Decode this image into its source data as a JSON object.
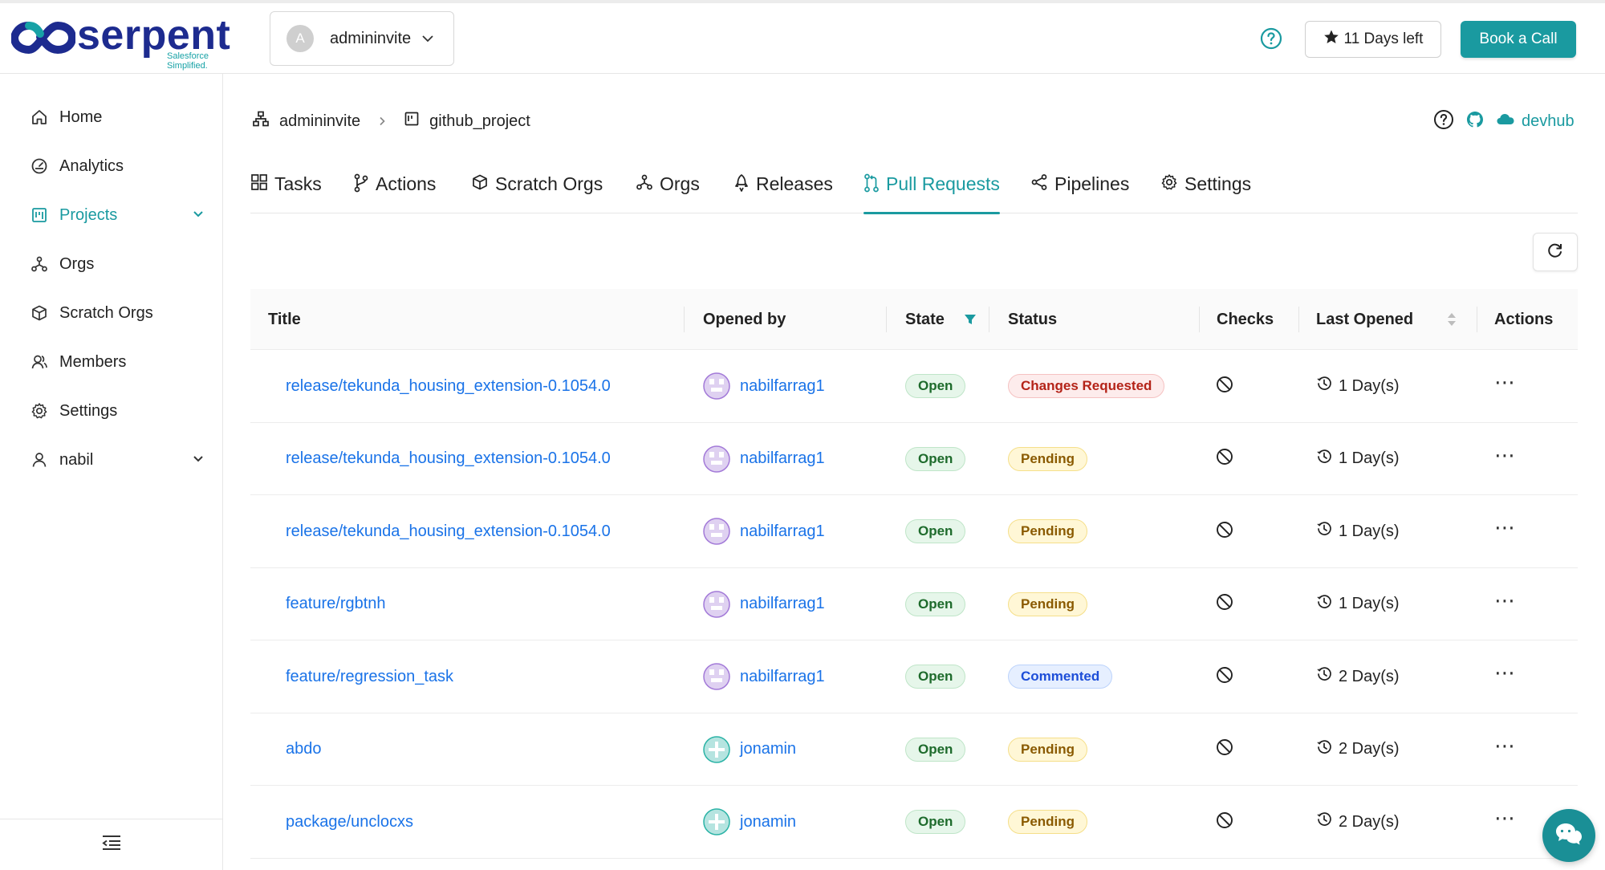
{
  "brand": {
    "name": "serpent",
    "tagline": "Salesforce Simplified.",
    "accent": "#1a9aa0",
    "link": "#1a73e8"
  },
  "workspace": {
    "avatar_letter": "A",
    "name": "admininvite"
  },
  "header": {
    "trial_label": "11 Days left",
    "book_label": "Book a Call",
    "help_icon": "question-circle-icon"
  },
  "sidebar": {
    "items": [
      {
        "label": "Home",
        "icon": "home-icon"
      },
      {
        "label": "Analytics",
        "icon": "gauge-icon"
      },
      {
        "label": "Projects",
        "icon": "project-icon",
        "active": true
      },
      {
        "label": "Orgs",
        "icon": "network-icon"
      },
      {
        "label": "Scratch Orgs",
        "icon": "box-icon"
      },
      {
        "label": "Members",
        "icon": "members-icon"
      },
      {
        "label": "Settings",
        "icon": "gear-icon"
      },
      {
        "label": "nabil",
        "icon": "user-icon"
      }
    ]
  },
  "breadcrumb": {
    "org": "admininvite",
    "project": "github_project",
    "devhub_label": "devhub"
  },
  "tabs": [
    {
      "label": "Tasks",
      "icon": "grid-icon"
    },
    {
      "label": "Actions",
      "icon": "branch-icon"
    },
    {
      "label": "Scratch Orgs",
      "icon": "box-icon"
    },
    {
      "label": "Orgs",
      "icon": "network-icon"
    },
    {
      "label": "Releases",
      "icon": "rocket-icon"
    },
    {
      "label": "Pull Requests",
      "icon": "pull-request-icon",
      "active": true
    },
    {
      "label": "Pipelines",
      "icon": "share-icon"
    },
    {
      "label": "Settings",
      "icon": "gear-icon"
    }
  ],
  "table": {
    "headers": {
      "title": "Title",
      "opened_by": "Opened by",
      "state": "State",
      "status": "Status",
      "checks": "Checks",
      "last_opened": "Last Opened",
      "actions": "Actions"
    },
    "rows": [
      {
        "title": "release/tekunda_housing_extension-0.1054.0",
        "opened_by": "nabilfarrag1",
        "state": "Open",
        "status": "Changes Requested",
        "status_kind": "changes",
        "age": "1 Day(s)"
      },
      {
        "title": "release/tekunda_housing_extension-0.1054.0",
        "opened_by": "nabilfarrag1",
        "state": "Open",
        "status": "Pending",
        "status_kind": "pending",
        "age": "1 Day(s)"
      },
      {
        "title": "release/tekunda_housing_extension-0.1054.0",
        "opened_by": "nabilfarrag1",
        "state": "Open",
        "status": "Pending",
        "status_kind": "pending",
        "age": "1 Day(s)"
      },
      {
        "title": "feature/rgbtnh",
        "opened_by": "nabilfarrag1",
        "state": "Open",
        "status": "Pending",
        "status_kind": "pending",
        "age": "1 Day(s)"
      },
      {
        "title": "feature/regression_task",
        "opened_by": "nabilfarrag1",
        "state": "Open",
        "status": "Commented",
        "status_kind": "commented",
        "age": "2 Day(s)"
      },
      {
        "title": "abdo",
        "opened_by": "jonamin",
        "state": "Open",
        "status": "Pending",
        "status_kind": "pending",
        "age": "2 Day(s)"
      },
      {
        "title": "package/unclocxs",
        "opened_by": "jonamin",
        "state": "Open",
        "status": "Pending",
        "status_kind": "pending",
        "age": "2 Day(s)"
      }
    ]
  }
}
